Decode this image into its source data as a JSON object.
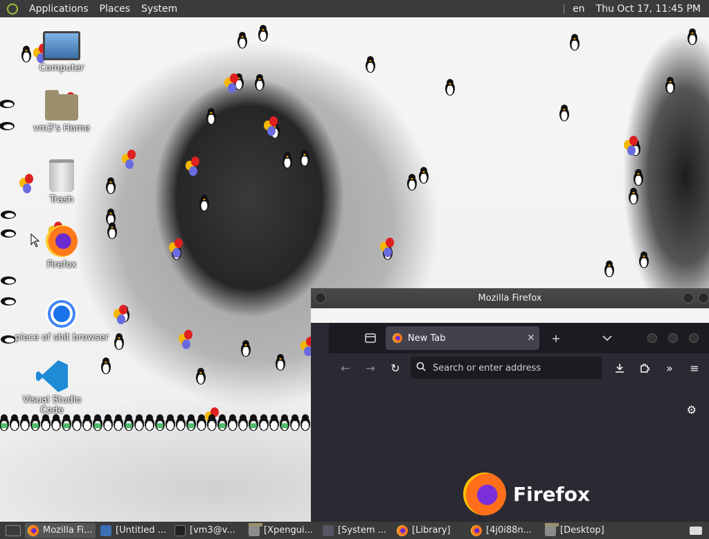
{
  "top_panel": {
    "menus": [
      "Applications",
      "Places",
      "System"
    ],
    "keyboard_layout": "en",
    "clock": "Thu Oct 17, 11:45 PM"
  },
  "desktop": {
    "icons": [
      {
        "label": "Computer"
      },
      {
        "label": "vm3's Home"
      },
      {
        "label": "Trash"
      },
      {
        "label": "Firefox"
      },
      {
        "label": "piece of shit browser"
      },
      {
        "label": "Visual Studio Code"
      }
    ]
  },
  "firefox": {
    "window_title": "Mozilla Firefox",
    "tab_label": "New Tab",
    "url_placeholder": "Search or enter address",
    "brand": "Firefox"
  },
  "taskbar": {
    "tasks": [
      "Mozilla Fi...",
      "[Untitled ...",
      "[vm3@v...",
      "[Xpengui...",
      "[System ...",
      "[Library]",
      "[4j0i88n...",
      "[Desktop]"
    ]
  }
}
